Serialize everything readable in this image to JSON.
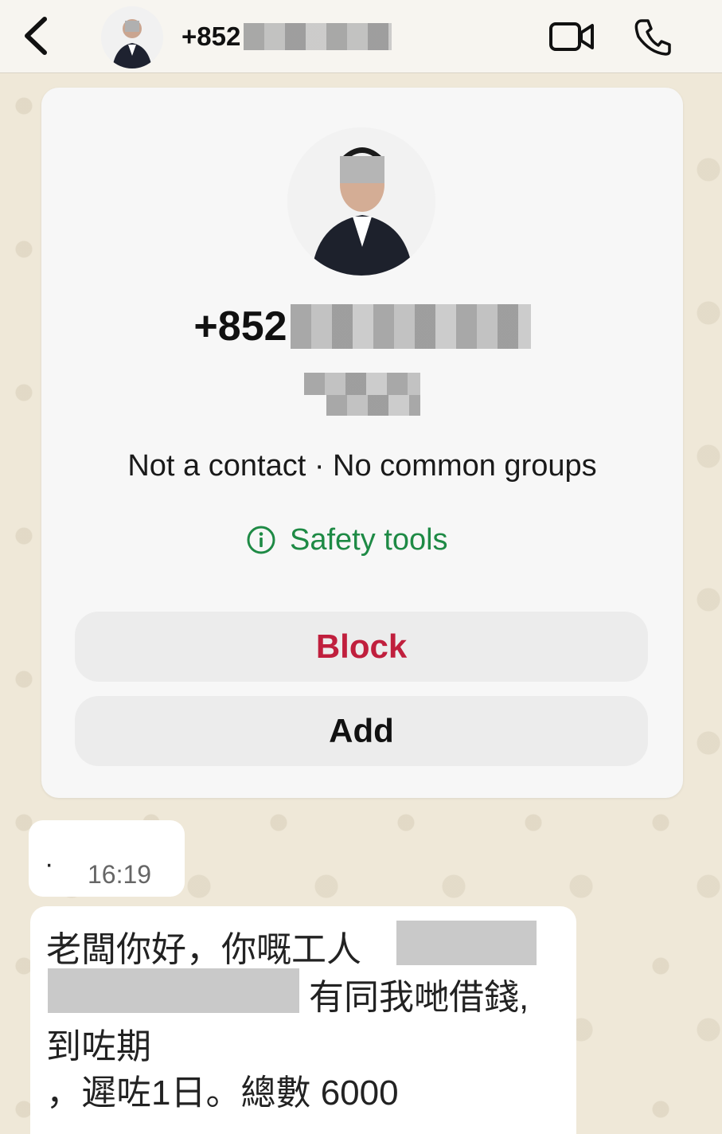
{
  "header": {
    "number_prefix": "+852"
  },
  "profile": {
    "number_prefix": "+852",
    "status": "Not a contact  ·  No common groups",
    "safety_label": "Safety tools"
  },
  "actions": {
    "block_label": "Block",
    "add_label": "Add"
  },
  "messages": [
    {
      "text": "·",
      "time": "16:19"
    },
    {
      "lines": [
        "老闆你好，你嘅工人",
        "有同我哋借錢,",
        "到咗期",
        "，遲咗1日。總數 6000"
      ]
    }
  ],
  "colors": {
    "accent_green": "#1e8a45",
    "block_red": "#c01f3d"
  }
}
